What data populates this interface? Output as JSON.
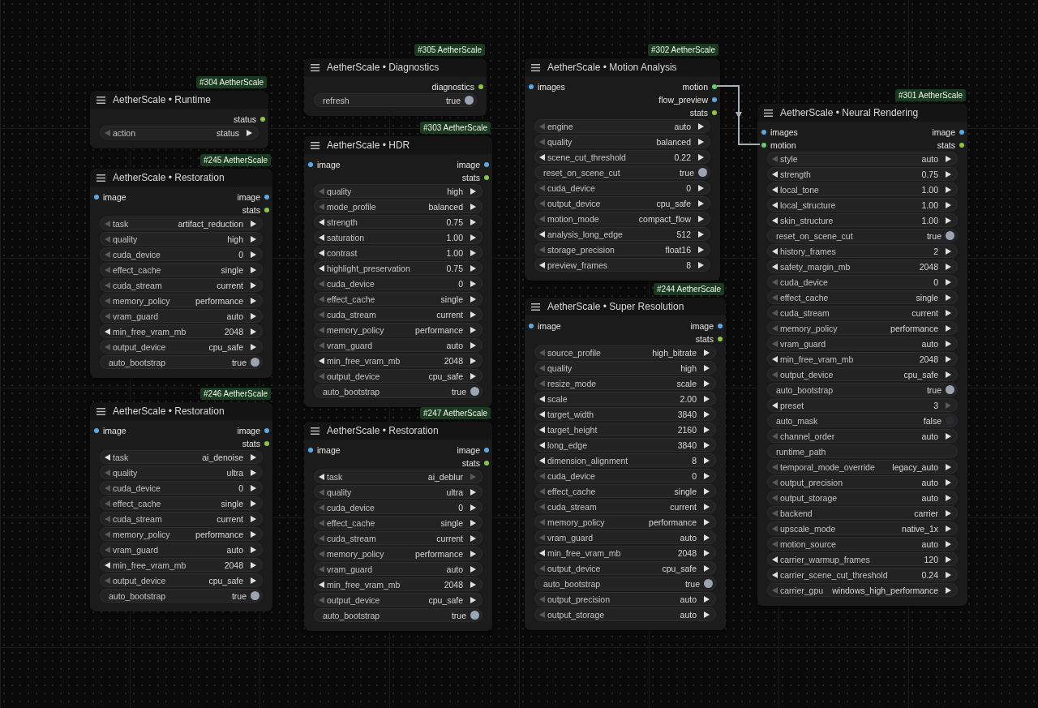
{
  "nodes": [
    {
      "badge": "#304 AetherScale",
      "title": "AetherScale • Runtime",
      "outputs": [
        {
          "label": "status",
          "color": "#8cc63f"
        }
      ],
      "widgets": [
        {
          "kind": "combo",
          "label": "action",
          "value": "status",
          "prev_enabled": false,
          "next_enabled": true
        }
      ]
    },
    {
      "badge": "#245 AetherScale",
      "title": "AetherScale • Restoration",
      "inputs": [
        {
          "label": "image",
          "color": "#5aa9e6"
        }
      ],
      "outputs": [
        {
          "label": "image",
          "color": "#5aa9e6"
        },
        {
          "label": "stats",
          "color": "#8cc63f"
        }
      ],
      "widgets": [
        {
          "kind": "combo",
          "label": "task",
          "value": "artifact_reduction",
          "prev_enabled": false,
          "next_enabled": true
        },
        {
          "kind": "combo",
          "label": "quality",
          "value": "high",
          "prev_enabled": false,
          "next_enabled": true
        },
        {
          "kind": "combo",
          "label": "cuda_device",
          "value": "0",
          "prev_enabled": false,
          "next_enabled": true
        },
        {
          "kind": "combo",
          "label": "effect_cache",
          "value": "single",
          "prev_enabled": false,
          "next_enabled": true
        },
        {
          "kind": "combo",
          "label": "cuda_stream",
          "value": "current",
          "prev_enabled": false,
          "next_enabled": true
        },
        {
          "kind": "combo",
          "label": "memory_policy",
          "value": "performance",
          "prev_enabled": false,
          "next_enabled": true
        },
        {
          "kind": "combo",
          "label": "vram_guard",
          "value": "auto",
          "prev_enabled": false,
          "next_enabled": true
        },
        {
          "kind": "combo",
          "label": "min_free_vram_mb",
          "value": "2048",
          "prev_enabled": true,
          "next_enabled": true
        },
        {
          "kind": "combo",
          "label": "output_device",
          "value": "cpu_safe",
          "prev_enabled": false,
          "next_enabled": true
        },
        {
          "kind": "toggle",
          "label": "auto_bootstrap",
          "value": "true",
          "on": true
        }
      ]
    },
    {
      "badge": "#246 AetherScale",
      "title": "AetherScale • Restoration",
      "inputs": [
        {
          "label": "image",
          "color": "#5aa9e6"
        }
      ],
      "outputs": [
        {
          "label": "image",
          "color": "#5aa9e6"
        },
        {
          "label": "stats",
          "color": "#8cc63f"
        }
      ],
      "widgets": [
        {
          "kind": "combo",
          "label": "task",
          "value": "ai_denoise",
          "prev_enabled": true,
          "next_enabled": true
        },
        {
          "kind": "combo",
          "label": "quality",
          "value": "ultra",
          "prev_enabled": false,
          "next_enabled": true
        },
        {
          "kind": "combo",
          "label": "cuda_device",
          "value": "0",
          "prev_enabled": false,
          "next_enabled": true
        },
        {
          "kind": "combo",
          "label": "effect_cache",
          "value": "single",
          "prev_enabled": false,
          "next_enabled": true
        },
        {
          "kind": "combo",
          "label": "cuda_stream",
          "value": "current",
          "prev_enabled": false,
          "next_enabled": true
        },
        {
          "kind": "combo",
          "label": "memory_policy",
          "value": "performance",
          "prev_enabled": false,
          "next_enabled": true
        },
        {
          "kind": "combo",
          "label": "vram_guard",
          "value": "auto",
          "prev_enabled": false,
          "next_enabled": true
        },
        {
          "kind": "combo",
          "label": "min_free_vram_mb",
          "value": "2048",
          "prev_enabled": true,
          "next_enabled": true
        },
        {
          "kind": "combo",
          "label": "output_device",
          "value": "cpu_safe",
          "prev_enabled": false,
          "next_enabled": true
        },
        {
          "kind": "toggle",
          "label": "auto_bootstrap",
          "value": "true",
          "on": true
        }
      ]
    },
    {
      "badge": "#305 AetherScale",
      "title": "AetherScale • Diagnostics",
      "outputs": [
        {
          "label": "diagnostics",
          "color": "#8cc63f"
        }
      ],
      "widgets": [
        {
          "kind": "toggle",
          "label": "refresh",
          "value": "true",
          "on": true
        }
      ]
    },
    {
      "badge": "#303 AetherScale",
      "title": "AetherScale • HDR",
      "inputs": [
        {
          "label": "image",
          "color": "#5aa9e6"
        }
      ],
      "outputs": [
        {
          "label": "image",
          "color": "#5aa9e6"
        },
        {
          "label": "stats",
          "color": "#8cc63f"
        }
      ],
      "widgets": [
        {
          "kind": "combo",
          "label": "quality",
          "value": "high",
          "prev_enabled": false,
          "next_enabled": true
        },
        {
          "kind": "combo",
          "label": "mode_profile",
          "value": "balanced",
          "prev_enabled": false,
          "next_enabled": true
        },
        {
          "kind": "combo",
          "label": "strength",
          "value": "0.75",
          "prev_enabled": true,
          "next_enabled": true
        },
        {
          "kind": "combo",
          "label": "saturation",
          "value": "1.00",
          "prev_enabled": true,
          "next_enabled": true
        },
        {
          "kind": "combo",
          "label": "contrast",
          "value": "1.00",
          "prev_enabled": true,
          "next_enabled": true
        },
        {
          "kind": "combo",
          "label": "highlight_preservation",
          "value": "0.75",
          "prev_enabled": true,
          "next_enabled": true
        },
        {
          "kind": "combo",
          "label": "cuda_device",
          "value": "0",
          "prev_enabled": false,
          "next_enabled": true
        },
        {
          "kind": "combo",
          "label": "effect_cache",
          "value": "single",
          "prev_enabled": false,
          "next_enabled": true
        },
        {
          "kind": "combo",
          "label": "cuda_stream",
          "value": "current",
          "prev_enabled": false,
          "next_enabled": true
        },
        {
          "kind": "combo",
          "label": "memory_policy",
          "value": "performance",
          "prev_enabled": false,
          "next_enabled": true
        },
        {
          "kind": "combo",
          "label": "vram_guard",
          "value": "auto",
          "prev_enabled": false,
          "next_enabled": true
        },
        {
          "kind": "combo",
          "label": "min_free_vram_mb",
          "value": "2048",
          "prev_enabled": true,
          "next_enabled": true
        },
        {
          "kind": "combo",
          "label": "output_device",
          "value": "cpu_safe",
          "prev_enabled": false,
          "next_enabled": true
        },
        {
          "kind": "toggle",
          "label": "auto_bootstrap",
          "value": "true",
          "on": true
        }
      ]
    },
    {
      "badge": "#247 AetherScale",
      "title": "AetherScale • Restoration",
      "inputs": [
        {
          "label": "image",
          "color": "#5aa9e6"
        }
      ],
      "outputs": [
        {
          "label": "image",
          "color": "#5aa9e6"
        },
        {
          "label": "stats",
          "color": "#8cc63f"
        }
      ],
      "widgets": [
        {
          "kind": "combo",
          "label": "task",
          "value": "ai_deblur",
          "prev_enabled": true,
          "next_enabled": false
        },
        {
          "kind": "combo",
          "label": "quality",
          "value": "ultra",
          "prev_enabled": false,
          "next_enabled": true
        },
        {
          "kind": "combo",
          "label": "cuda_device",
          "value": "0",
          "prev_enabled": false,
          "next_enabled": true
        },
        {
          "kind": "combo",
          "label": "effect_cache",
          "value": "single",
          "prev_enabled": false,
          "next_enabled": true
        },
        {
          "kind": "combo",
          "label": "cuda_stream",
          "value": "current",
          "prev_enabled": false,
          "next_enabled": true
        },
        {
          "kind": "combo",
          "label": "memory_policy",
          "value": "performance",
          "prev_enabled": false,
          "next_enabled": true
        },
        {
          "kind": "combo",
          "label": "vram_guard",
          "value": "auto",
          "prev_enabled": false,
          "next_enabled": true
        },
        {
          "kind": "combo",
          "label": "min_free_vram_mb",
          "value": "2048",
          "prev_enabled": true,
          "next_enabled": true
        },
        {
          "kind": "combo",
          "label": "output_device",
          "value": "cpu_safe",
          "prev_enabled": false,
          "next_enabled": true
        },
        {
          "kind": "toggle",
          "label": "auto_bootstrap",
          "value": "true",
          "on": true
        }
      ]
    },
    {
      "badge": "#302 AetherScale",
      "title": "AetherScale • Motion Analysis",
      "inputs": [
        {
          "label": "images",
          "color": "#5aa9e6"
        }
      ],
      "outputs": [
        {
          "label": "motion",
          "color": "#5fd35f"
        },
        {
          "label": "flow_preview",
          "color": "#5aa9e6"
        },
        {
          "label": "stats",
          "color": "#8cc63f"
        }
      ],
      "widgets": [
        {
          "kind": "combo",
          "label": "engine",
          "value": "auto",
          "prev_enabled": false,
          "next_enabled": true
        },
        {
          "kind": "combo",
          "label": "quality",
          "value": "balanced",
          "prev_enabled": false,
          "next_enabled": true
        },
        {
          "kind": "combo",
          "label": "scene_cut_threshold",
          "value": "0.22",
          "prev_enabled": true,
          "next_enabled": true
        },
        {
          "kind": "toggle",
          "label": "reset_on_scene_cut",
          "value": "true",
          "on": true
        },
        {
          "kind": "combo",
          "label": "cuda_device",
          "value": "0",
          "prev_enabled": false,
          "next_enabled": true
        },
        {
          "kind": "combo",
          "label": "output_device",
          "value": "cpu_safe",
          "prev_enabled": false,
          "next_enabled": true
        },
        {
          "kind": "combo",
          "label": "motion_mode",
          "value": "compact_flow",
          "prev_enabled": false,
          "next_enabled": true
        },
        {
          "kind": "combo",
          "label": "analysis_long_edge",
          "value": "512",
          "prev_enabled": true,
          "next_enabled": true
        },
        {
          "kind": "combo",
          "label": "storage_precision",
          "value": "float16",
          "prev_enabled": false,
          "next_enabled": true
        },
        {
          "kind": "combo",
          "label": "preview_frames",
          "value": "8",
          "prev_enabled": true,
          "next_enabled": true
        }
      ]
    },
    {
      "badge": "#244 AetherScale",
      "title": "AetherScale • Super Resolution",
      "inputs": [
        {
          "label": "image",
          "color": "#5aa9e6"
        }
      ],
      "outputs": [
        {
          "label": "image",
          "color": "#5aa9e6"
        },
        {
          "label": "stats",
          "color": "#8cc63f"
        }
      ],
      "widgets": [
        {
          "kind": "combo",
          "label": "source_profile",
          "value": "high_bitrate",
          "prev_enabled": false,
          "next_enabled": true
        },
        {
          "kind": "combo",
          "label": "quality",
          "value": "high",
          "prev_enabled": false,
          "next_enabled": true
        },
        {
          "kind": "combo",
          "label": "resize_mode",
          "value": "scale",
          "prev_enabled": false,
          "next_enabled": true
        },
        {
          "kind": "combo",
          "label": "scale",
          "value": "2.00",
          "prev_enabled": true,
          "next_enabled": true
        },
        {
          "kind": "combo",
          "label": "target_width",
          "value": "3840",
          "prev_enabled": true,
          "next_enabled": true
        },
        {
          "kind": "combo",
          "label": "target_height",
          "value": "2160",
          "prev_enabled": true,
          "next_enabled": true
        },
        {
          "kind": "combo",
          "label": "long_edge",
          "value": "3840",
          "prev_enabled": true,
          "next_enabled": true
        },
        {
          "kind": "combo",
          "label": "dimension_alignment",
          "value": "8",
          "prev_enabled": true,
          "next_enabled": true
        },
        {
          "kind": "combo",
          "label": "cuda_device",
          "value": "0",
          "prev_enabled": false,
          "next_enabled": true
        },
        {
          "kind": "combo",
          "label": "effect_cache",
          "value": "single",
          "prev_enabled": false,
          "next_enabled": true
        },
        {
          "kind": "combo",
          "label": "cuda_stream",
          "value": "current",
          "prev_enabled": false,
          "next_enabled": true
        },
        {
          "kind": "combo",
          "label": "memory_policy",
          "value": "performance",
          "prev_enabled": false,
          "next_enabled": true
        },
        {
          "kind": "combo",
          "label": "vram_guard",
          "value": "auto",
          "prev_enabled": false,
          "next_enabled": true
        },
        {
          "kind": "combo",
          "label": "min_free_vram_mb",
          "value": "2048",
          "prev_enabled": true,
          "next_enabled": true
        },
        {
          "kind": "combo",
          "label": "output_device",
          "value": "cpu_safe",
          "prev_enabled": false,
          "next_enabled": true
        },
        {
          "kind": "toggle",
          "label": "auto_bootstrap",
          "value": "true",
          "on": true
        },
        {
          "kind": "combo",
          "label": "output_precision",
          "value": "auto",
          "prev_enabled": false,
          "next_enabled": true
        },
        {
          "kind": "combo",
          "label": "output_storage",
          "value": "auto",
          "prev_enabled": false,
          "next_enabled": true
        }
      ]
    },
    {
      "badge": "#301 AetherScale",
      "title": "AetherScale • Neural Rendering",
      "inputs": [
        {
          "label": "images",
          "color": "#5aa9e6"
        },
        {
          "label": "motion",
          "color": "#5fd35f"
        }
      ],
      "outputs": [
        {
          "label": "image",
          "color": "#5aa9e6"
        },
        {
          "label": "stats",
          "color": "#8cc63f"
        }
      ],
      "widgets": [
        {
          "kind": "combo",
          "label": "style",
          "value": "auto",
          "prev_enabled": false,
          "next_enabled": true
        },
        {
          "kind": "combo",
          "label": "strength",
          "value": "0.75",
          "prev_enabled": true,
          "next_enabled": true
        },
        {
          "kind": "combo",
          "label": "local_tone",
          "value": "1.00",
          "prev_enabled": true,
          "next_enabled": true
        },
        {
          "kind": "combo",
          "label": "local_structure",
          "value": "1.00",
          "prev_enabled": true,
          "next_enabled": true
        },
        {
          "kind": "combo",
          "label": "skin_structure",
          "value": "1.00",
          "prev_enabled": true,
          "next_enabled": true
        },
        {
          "kind": "toggle",
          "label": "reset_on_scene_cut",
          "value": "true",
          "on": true
        },
        {
          "kind": "combo",
          "label": "history_frames",
          "value": "2",
          "prev_enabled": true,
          "next_enabled": true
        },
        {
          "kind": "combo",
          "label": "safety_margin_mb",
          "value": "2048",
          "prev_enabled": true,
          "next_enabled": true
        },
        {
          "kind": "combo",
          "label": "cuda_device",
          "value": "0",
          "prev_enabled": false,
          "next_enabled": true
        },
        {
          "kind": "combo",
          "label": "effect_cache",
          "value": "single",
          "prev_enabled": false,
          "next_enabled": true
        },
        {
          "kind": "combo",
          "label": "cuda_stream",
          "value": "current",
          "prev_enabled": false,
          "next_enabled": true
        },
        {
          "kind": "combo",
          "label": "memory_policy",
          "value": "performance",
          "prev_enabled": false,
          "next_enabled": true
        },
        {
          "kind": "combo",
          "label": "vram_guard",
          "value": "auto",
          "prev_enabled": false,
          "next_enabled": true
        },
        {
          "kind": "combo",
          "label": "min_free_vram_mb",
          "value": "2048",
          "prev_enabled": true,
          "next_enabled": true
        },
        {
          "kind": "combo",
          "label": "output_device",
          "value": "cpu_safe",
          "prev_enabled": false,
          "next_enabled": true
        },
        {
          "kind": "toggle",
          "label": "auto_bootstrap",
          "value": "true",
          "on": true
        },
        {
          "kind": "combo",
          "label": "preset",
          "value": "3",
          "prev_enabled": true,
          "next_enabled": false
        },
        {
          "kind": "toggle",
          "label": "auto_mask",
          "value": "false",
          "on": false
        },
        {
          "kind": "combo",
          "label": "channel_order",
          "value": "auto",
          "prev_enabled": false,
          "next_enabled": true
        },
        {
          "kind": "text",
          "label": "runtime_path"
        },
        {
          "kind": "combo",
          "label": "temporal_mode_override",
          "value": "legacy_auto",
          "prev_enabled": false,
          "next_enabled": true
        },
        {
          "kind": "combo",
          "label": "output_precision",
          "value": "auto",
          "prev_enabled": false,
          "next_enabled": true
        },
        {
          "kind": "combo",
          "label": "output_storage",
          "value": "auto",
          "prev_enabled": false,
          "next_enabled": true
        },
        {
          "kind": "combo",
          "label": "backend",
          "value": "carrier",
          "prev_enabled": false,
          "next_enabled": true
        },
        {
          "kind": "combo",
          "label": "upscale_mode",
          "value": "native_1x",
          "prev_enabled": false,
          "next_enabled": true
        },
        {
          "kind": "combo",
          "label": "motion_source",
          "value": "auto",
          "prev_enabled": false,
          "next_enabled": true
        },
        {
          "kind": "combo",
          "label": "carrier_warmup_frames",
          "value": "120",
          "prev_enabled": true,
          "next_enabled": true
        },
        {
          "kind": "combo",
          "label": "carrier_scene_cut_threshold",
          "value": "0.24",
          "prev_enabled": true,
          "next_enabled": true
        },
        {
          "kind": "combo",
          "label": "carrier_gpu",
          "value": "windows_high_performance",
          "prev_enabled": false,
          "next_enabled": true
        }
      ]
    }
  ]
}
